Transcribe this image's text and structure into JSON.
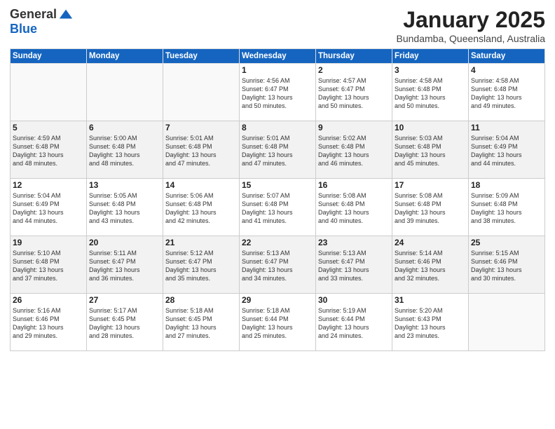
{
  "header": {
    "logo_general": "General",
    "logo_blue": "Blue",
    "month_title": "January 2025",
    "location": "Bundamba, Queensland, Australia"
  },
  "days_of_week": [
    "Sunday",
    "Monday",
    "Tuesday",
    "Wednesday",
    "Thursday",
    "Friday",
    "Saturday"
  ],
  "weeks": [
    [
      {
        "day": "",
        "text": ""
      },
      {
        "day": "",
        "text": ""
      },
      {
        "day": "",
        "text": ""
      },
      {
        "day": "1",
        "text": "Sunrise: 4:56 AM\nSunset: 6:47 PM\nDaylight: 13 hours\nand 50 minutes."
      },
      {
        "day": "2",
        "text": "Sunrise: 4:57 AM\nSunset: 6:47 PM\nDaylight: 13 hours\nand 50 minutes."
      },
      {
        "day": "3",
        "text": "Sunrise: 4:58 AM\nSunset: 6:48 PM\nDaylight: 13 hours\nand 50 minutes."
      },
      {
        "day": "4",
        "text": "Sunrise: 4:58 AM\nSunset: 6:48 PM\nDaylight: 13 hours\nand 49 minutes."
      }
    ],
    [
      {
        "day": "5",
        "text": "Sunrise: 4:59 AM\nSunset: 6:48 PM\nDaylight: 13 hours\nand 48 minutes."
      },
      {
        "day": "6",
        "text": "Sunrise: 5:00 AM\nSunset: 6:48 PM\nDaylight: 13 hours\nand 48 minutes."
      },
      {
        "day": "7",
        "text": "Sunrise: 5:01 AM\nSunset: 6:48 PM\nDaylight: 13 hours\nand 47 minutes."
      },
      {
        "day": "8",
        "text": "Sunrise: 5:01 AM\nSunset: 6:48 PM\nDaylight: 13 hours\nand 47 minutes."
      },
      {
        "day": "9",
        "text": "Sunrise: 5:02 AM\nSunset: 6:48 PM\nDaylight: 13 hours\nand 46 minutes."
      },
      {
        "day": "10",
        "text": "Sunrise: 5:03 AM\nSunset: 6:48 PM\nDaylight: 13 hours\nand 45 minutes."
      },
      {
        "day": "11",
        "text": "Sunrise: 5:04 AM\nSunset: 6:49 PM\nDaylight: 13 hours\nand 44 minutes."
      }
    ],
    [
      {
        "day": "12",
        "text": "Sunrise: 5:04 AM\nSunset: 6:49 PM\nDaylight: 13 hours\nand 44 minutes."
      },
      {
        "day": "13",
        "text": "Sunrise: 5:05 AM\nSunset: 6:48 PM\nDaylight: 13 hours\nand 43 minutes."
      },
      {
        "day": "14",
        "text": "Sunrise: 5:06 AM\nSunset: 6:48 PM\nDaylight: 13 hours\nand 42 minutes."
      },
      {
        "day": "15",
        "text": "Sunrise: 5:07 AM\nSunset: 6:48 PM\nDaylight: 13 hours\nand 41 minutes."
      },
      {
        "day": "16",
        "text": "Sunrise: 5:08 AM\nSunset: 6:48 PM\nDaylight: 13 hours\nand 40 minutes."
      },
      {
        "day": "17",
        "text": "Sunrise: 5:08 AM\nSunset: 6:48 PM\nDaylight: 13 hours\nand 39 minutes."
      },
      {
        "day": "18",
        "text": "Sunrise: 5:09 AM\nSunset: 6:48 PM\nDaylight: 13 hours\nand 38 minutes."
      }
    ],
    [
      {
        "day": "19",
        "text": "Sunrise: 5:10 AM\nSunset: 6:48 PM\nDaylight: 13 hours\nand 37 minutes."
      },
      {
        "day": "20",
        "text": "Sunrise: 5:11 AM\nSunset: 6:47 PM\nDaylight: 13 hours\nand 36 minutes."
      },
      {
        "day": "21",
        "text": "Sunrise: 5:12 AM\nSunset: 6:47 PM\nDaylight: 13 hours\nand 35 minutes."
      },
      {
        "day": "22",
        "text": "Sunrise: 5:13 AM\nSunset: 6:47 PM\nDaylight: 13 hours\nand 34 minutes."
      },
      {
        "day": "23",
        "text": "Sunrise: 5:13 AM\nSunset: 6:47 PM\nDaylight: 13 hours\nand 33 minutes."
      },
      {
        "day": "24",
        "text": "Sunrise: 5:14 AM\nSunset: 6:46 PM\nDaylight: 13 hours\nand 32 minutes."
      },
      {
        "day": "25",
        "text": "Sunrise: 5:15 AM\nSunset: 6:46 PM\nDaylight: 13 hours\nand 30 minutes."
      }
    ],
    [
      {
        "day": "26",
        "text": "Sunrise: 5:16 AM\nSunset: 6:46 PM\nDaylight: 13 hours\nand 29 minutes."
      },
      {
        "day": "27",
        "text": "Sunrise: 5:17 AM\nSunset: 6:45 PM\nDaylight: 13 hours\nand 28 minutes."
      },
      {
        "day": "28",
        "text": "Sunrise: 5:18 AM\nSunset: 6:45 PM\nDaylight: 13 hours\nand 27 minutes."
      },
      {
        "day": "29",
        "text": "Sunrise: 5:18 AM\nSunset: 6:44 PM\nDaylight: 13 hours\nand 25 minutes."
      },
      {
        "day": "30",
        "text": "Sunrise: 5:19 AM\nSunset: 6:44 PM\nDaylight: 13 hours\nand 24 minutes."
      },
      {
        "day": "31",
        "text": "Sunrise: 5:20 AM\nSunset: 6:43 PM\nDaylight: 13 hours\nand 23 minutes."
      },
      {
        "day": "",
        "text": ""
      }
    ]
  ]
}
